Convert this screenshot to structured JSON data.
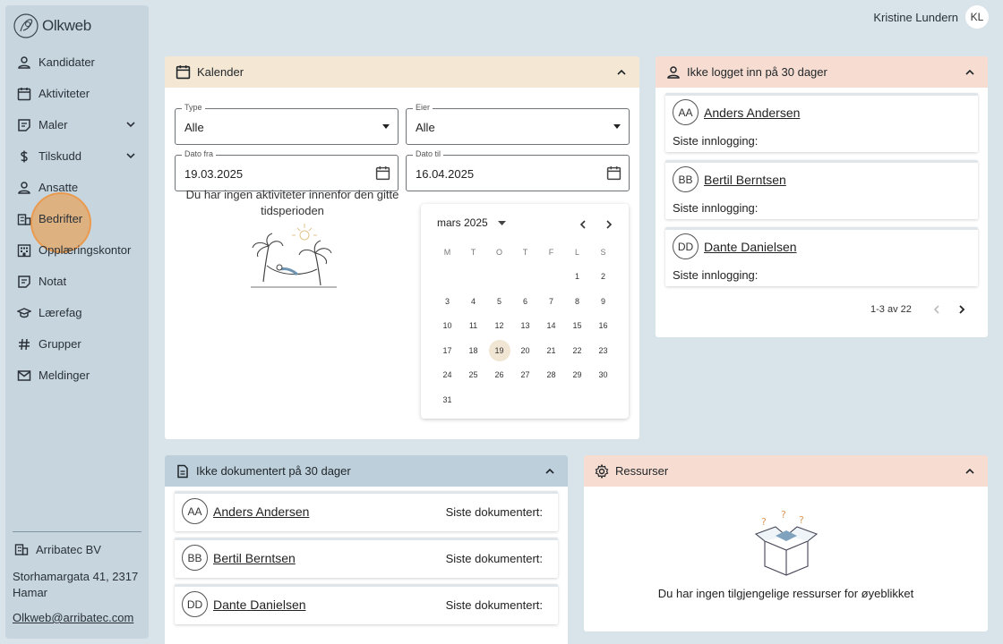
{
  "app": {
    "logo_text": "Olkweb"
  },
  "user": {
    "name": "Kristine Lundern",
    "initials": "KL"
  },
  "sidebar": {
    "items": [
      {
        "label": "Kandidater",
        "icon": "person-icon"
      },
      {
        "label": "Aktiviteter",
        "icon": "calendar-icon"
      },
      {
        "label": "Maler",
        "icon": "template-icon"
      },
      {
        "label": "Tilskudd",
        "icon": "dollar-icon"
      },
      {
        "label": "Ansatte",
        "icon": "person-icon"
      },
      {
        "label": "Bedrifter",
        "icon": "building-icon"
      },
      {
        "label": "Opplæringskontor",
        "icon": "office-building-icon"
      },
      {
        "label": "Notat",
        "icon": "note-icon"
      },
      {
        "label": "Lærefag",
        "icon": "graduation-icon"
      },
      {
        "label": "Grupper",
        "icon": "hash-icon"
      },
      {
        "label": "Meldinger",
        "icon": "mail-icon"
      }
    ],
    "company": "Arribatec BV",
    "address": "Storhamargata 41, 2317 Hamar",
    "email": "Olkweb@arribatec.com"
  },
  "calendar_card": {
    "title": "Kalender",
    "type_label": "Type",
    "type_value": "Alle",
    "owner_label": "Eier",
    "owner_value": "Alle",
    "from_label": "Dato fra",
    "from_value": "19.03.2025",
    "to_label": "Dato til",
    "to_value": "16.04.2025",
    "empty_text": "Du har ingen aktiviteter innenfor den gitte tidsperioden",
    "picker": {
      "month_label": "mars 2025",
      "weekdays": [
        "M",
        "T",
        "O",
        "T",
        "F",
        "L",
        "S"
      ],
      "weeks": [
        [
          "",
          "",
          "",
          "",
          "",
          "1",
          "2"
        ],
        [
          "3",
          "4",
          "5",
          "6",
          "7",
          "8",
          "9"
        ],
        [
          "10",
          "11",
          "12",
          "13",
          "14",
          "15",
          "16"
        ],
        [
          "17",
          "18",
          "19",
          "20",
          "21",
          "22",
          "23"
        ],
        [
          "24",
          "25",
          "26",
          "27",
          "28",
          "29",
          "30"
        ],
        [
          "31",
          "",
          "",
          "",
          "",
          "",
          ""
        ]
      ],
      "selected": "19"
    }
  },
  "not_logged": {
    "title": "Ikke logget inn på 30 dager",
    "sub_label": "Siste innlogging:",
    "people": [
      {
        "initials": "AA",
        "name": "Anders Andersen"
      },
      {
        "initials": "BB",
        "name": "Bertil Berntsen"
      },
      {
        "initials": "DD",
        "name": "Dante Danielsen"
      }
    ],
    "pagination": "1-3 av 22"
  },
  "not_documented": {
    "title": "Ikke dokumentert på 30 dager",
    "sub_label": "Siste dokumentert:",
    "people": [
      {
        "initials": "AA",
        "name": "Anders Andersen"
      },
      {
        "initials": "BB",
        "name": "Bertil Berntsen"
      },
      {
        "initials": "DD",
        "name": "Dante Danielsen"
      }
    ]
  },
  "resources": {
    "title": "Ressurser",
    "empty_text": "Du har ingen tilgjengelige ressurser for øyeblikket"
  }
}
